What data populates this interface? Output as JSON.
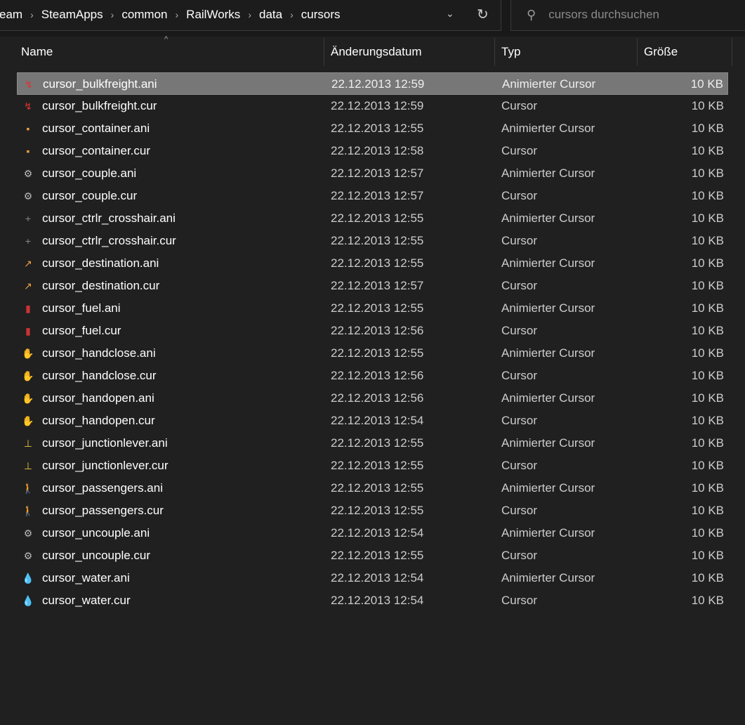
{
  "breadcrumb": [
    "eam",
    "SteamApps",
    "common",
    "RailWorks",
    "data",
    "cursors"
  ],
  "search": {
    "placeholder": "cursors durchsuchen"
  },
  "columns": {
    "name": "Name",
    "date": "Änderungsdatum",
    "type": "Typ",
    "size": "Größe"
  },
  "files": [
    {
      "name": "cursor_bulkfreight.ani",
      "date": "22.12.2013 12:59",
      "type": "Animierter Cursor",
      "size": "10 KB",
      "icon": "bulkfreight",
      "selected": true
    },
    {
      "name": "cursor_bulkfreight.cur",
      "date": "22.12.2013 12:59",
      "type": "Cursor",
      "size": "10 KB",
      "icon": "bulkfreight"
    },
    {
      "name": "cursor_container.ani",
      "date": "22.12.2013 12:55",
      "type": "Animierter Cursor",
      "size": "10 KB",
      "icon": "container"
    },
    {
      "name": "cursor_container.cur",
      "date": "22.12.2013 12:58",
      "type": "Cursor",
      "size": "10 KB",
      "icon": "container"
    },
    {
      "name": "cursor_couple.ani",
      "date": "22.12.2013 12:57",
      "type": "Animierter Cursor",
      "size": "10 KB",
      "icon": "couple"
    },
    {
      "name": "cursor_couple.cur",
      "date": "22.12.2013 12:57",
      "type": "Cursor",
      "size": "10 KB",
      "icon": "couple"
    },
    {
      "name": "cursor_ctrlr_crosshair.ani",
      "date": "22.12.2013 12:55",
      "type": "Animierter Cursor",
      "size": "10 KB",
      "icon": "crosshair"
    },
    {
      "name": "cursor_ctrlr_crosshair.cur",
      "date": "22.12.2013 12:55",
      "type": "Cursor",
      "size": "10 KB",
      "icon": "crosshair"
    },
    {
      "name": "cursor_destination.ani",
      "date": "22.12.2013 12:55",
      "type": "Animierter Cursor",
      "size": "10 KB",
      "icon": "destination"
    },
    {
      "name": "cursor_destination.cur",
      "date": "22.12.2013 12:57",
      "type": "Cursor",
      "size": "10 KB",
      "icon": "destination"
    },
    {
      "name": "cursor_fuel.ani",
      "date": "22.12.2013 12:55",
      "type": "Animierter Cursor",
      "size": "10 KB",
      "icon": "fuel"
    },
    {
      "name": "cursor_fuel.cur",
      "date": "22.12.2013 12:56",
      "type": "Cursor",
      "size": "10 KB",
      "icon": "fuel"
    },
    {
      "name": "cursor_handclose.ani",
      "date": "22.12.2013 12:55",
      "type": "Animierter Cursor",
      "size": "10 KB",
      "icon": "hand"
    },
    {
      "name": "cursor_handclose.cur",
      "date": "22.12.2013 12:56",
      "type": "Cursor",
      "size": "10 KB",
      "icon": "hand"
    },
    {
      "name": "cursor_handopen.ani",
      "date": "22.12.2013 12:56",
      "type": "Animierter Cursor",
      "size": "10 KB",
      "icon": "hand"
    },
    {
      "name": "cursor_handopen.cur",
      "date": "22.12.2013 12:54",
      "type": "Cursor",
      "size": "10 KB",
      "icon": "hand"
    },
    {
      "name": "cursor_junctionlever.ani",
      "date": "22.12.2013 12:55",
      "type": "Animierter Cursor",
      "size": "10 KB",
      "icon": "lever"
    },
    {
      "name": "cursor_junctionlever.cur",
      "date": "22.12.2013 12:55",
      "type": "Cursor",
      "size": "10 KB",
      "icon": "lever"
    },
    {
      "name": "cursor_passengers.ani",
      "date": "22.12.2013 12:55",
      "type": "Animierter Cursor",
      "size": "10 KB",
      "icon": "passenger"
    },
    {
      "name": "cursor_passengers.cur",
      "date": "22.12.2013 12:55",
      "type": "Cursor",
      "size": "10 KB",
      "icon": "passenger"
    },
    {
      "name": "cursor_uncouple.ani",
      "date": "22.12.2013 12:54",
      "type": "Animierter Cursor",
      "size": "10 KB",
      "icon": "uncouple"
    },
    {
      "name": "cursor_uncouple.cur",
      "date": "22.12.2013 12:55",
      "type": "Cursor",
      "size": "10 KB",
      "icon": "uncouple"
    },
    {
      "name": "cursor_water.ani",
      "date": "22.12.2013 12:54",
      "type": "Animierter Cursor",
      "size": "10 KB",
      "icon": "water"
    },
    {
      "name": "cursor_water.cur",
      "date": "22.12.2013 12:54",
      "type": "Cursor",
      "size": "10 KB",
      "icon": "water"
    }
  ]
}
